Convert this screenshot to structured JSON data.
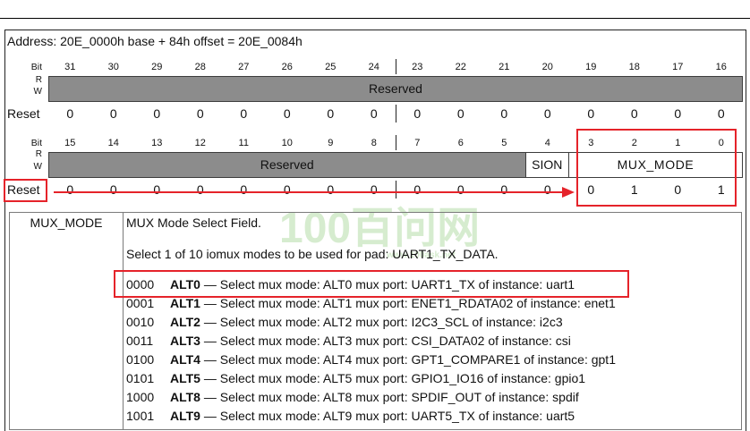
{
  "colors": {
    "annotation": "#e5232a",
    "reserved_fill": "#8c8c8c",
    "watermark": "#c9e6bf"
  },
  "register": {
    "address": "Address: 20E_0000h base + 84h offset = 20E_0084h",
    "bit_label": "Bit",
    "read_label": "R",
    "write_label": "W",
    "reset_label": "Reset",
    "upper": {
      "bits": [
        "31",
        "30",
        "29",
        "28",
        "27",
        "26",
        "25",
        "24",
        "23",
        "22",
        "21",
        "20",
        "19",
        "18",
        "17",
        "16"
      ],
      "fields": [
        {
          "name": "Reserved",
          "msb": 31,
          "lsb": 16
        }
      ],
      "reset": [
        "0",
        "0",
        "0",
        "0",
        "0",
        "0",
        "0",
        "0",
        "0",
        "0",
        "0",
        "0",
        "0",
        "0",
        "0",
        "0"
      ]
    },
    "lower": {
      "bits": [
        "15",
        "14",
        "13",
        "12",
        "11",
        "10",
        "9",
        "8",
        "7",
        "6",
        "5",
        "4",
        "3",
        "2",
        "1",
        "0"
      ],
      "fields": [
        {
          "name": "Reserved",
          "msb": 15,
          "lsb": 5
        },
        {
          "name": "SION",
          "msb": 4,
          "lsb": 4
        },
        {
          "name": "MUX_MODE",
          "msb": 3,
          "lsb": 0
        }
      ],
      "reset": [
        "0",
        "0",
        "0",
        "0",
        "0",
        "0",
        "0",
        "0",
        "0",
        "0",
        "0",
        "0",
        "0",
        "1",
        "0",
        "1"
      ]
    }
  },
  "field_description": {
    "field": "MUX_MODE",
    "title": "MUX Mode Select Field.",
    "summary": "Select 1 of 10 iomux modes to be used for pad: UART1_TX_DATA.",
    "modes": [
      {
        "code": "0000",
        "alt": "ALT0",
        "text": "— Select mux mode: ALT0 mux port: UART1_TX of instance: uart1"
      },
      {
        "code": "0001",
        "alt": "ALT1",
        "text": "— Select mux mode: ALT1 mux port: ENET1_RDATA02 of instance: enet1"
      },
      {
        "code": "0010",
        "alt": "ALT2",
        "text": "— Select mux mode: ALT2 mux port: I2C3_SCL of instance: i2c3"
      },
      {
        "code": "0011",
        "alt": "ALT3",
        "text": "— Select mux mode: ALT3 mux port: CSI_DATA02 of instance: csi"
      },
      {
        "code": "0100",
        "alt": "ALT4",
        "text": "— Select mux mode: ALT4 mux port: GPT1_COMPARE1 of instance: gpt1"
      },
      {
        "code": "0101",
        "alt": "ALT5",
        "text": "— Select mux mode: ALT5 mux port: GPIO1_IO16 of instance: gpio1"
      },
      {
        "code": "1000",
        "alt": "ALT8",
        "text": "— Select mux mode: ALT8 mux port: SPDIF_OUT of instance: spdif"
      },
      {
        "code": "1001",
        "alt": "ALT9",
        "text": "— Select mux mode: ALT9 mux port: UART5_TX of instance: uart5"
      }
    ]
  },
  "watermark": {
    "text": "100百问网",
    "url": "www.100ask.net"
  }
}
